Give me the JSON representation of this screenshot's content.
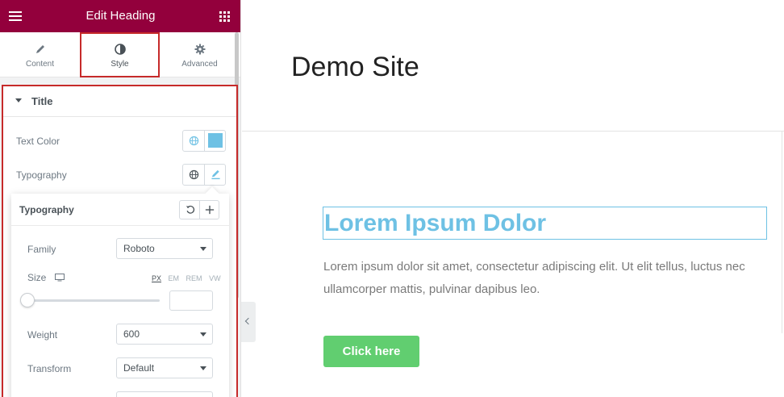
{
  "panel": {
    "title": "Edit Heading",
    "tabs": [
      {
        "label": "Content",
        "icon": "pencil-icon"
      },
      {
        "label": "Style",
        "icon": "half-circle-icon"
      },
      {
        "label": "Advanced",
        "icon": "gear-icon"
      }
    ],
    "active_tab": "Style",
    "section": {
      "title": "Title",
      "text_color_label": "Text Color",
      "text_color_value": "#6ec1e4",
      "typography_label": "Typography"
    },
    "typography_popover": {
      "title": "Typography",
      "family_label": "Family",
      "family_value": "Roboto",
      "size_label": "Size",
      "units": [
        "PX",
        "EM",
        "REM",
        "VW"
      ],
      "selected_unit": "PX",
      "size_value": "",
      "weight_label": "Weight",
      "weight_value": "600",
      "transform_label": "Transform",
      "transform_value": "Default"
    }
  },
  "preview": {
    "site_title": "Demo Site",
    "heading": "Lorem Ipsum Dolor",
    "paragraph": "Lorem ipsum dolor sit amet, consectetur adipiscing elit. Ut elit tellus, luctus nec ullamcorper mattis, pulvinar dapibus leo.",
    "button_label": "Click here"
  },
  "colors": {
    "brand": "#93003c",
    "heading": "#6ec1e4",
    "button": "#61ce70",
    "highlight": "#c62a2a"
  }
}
